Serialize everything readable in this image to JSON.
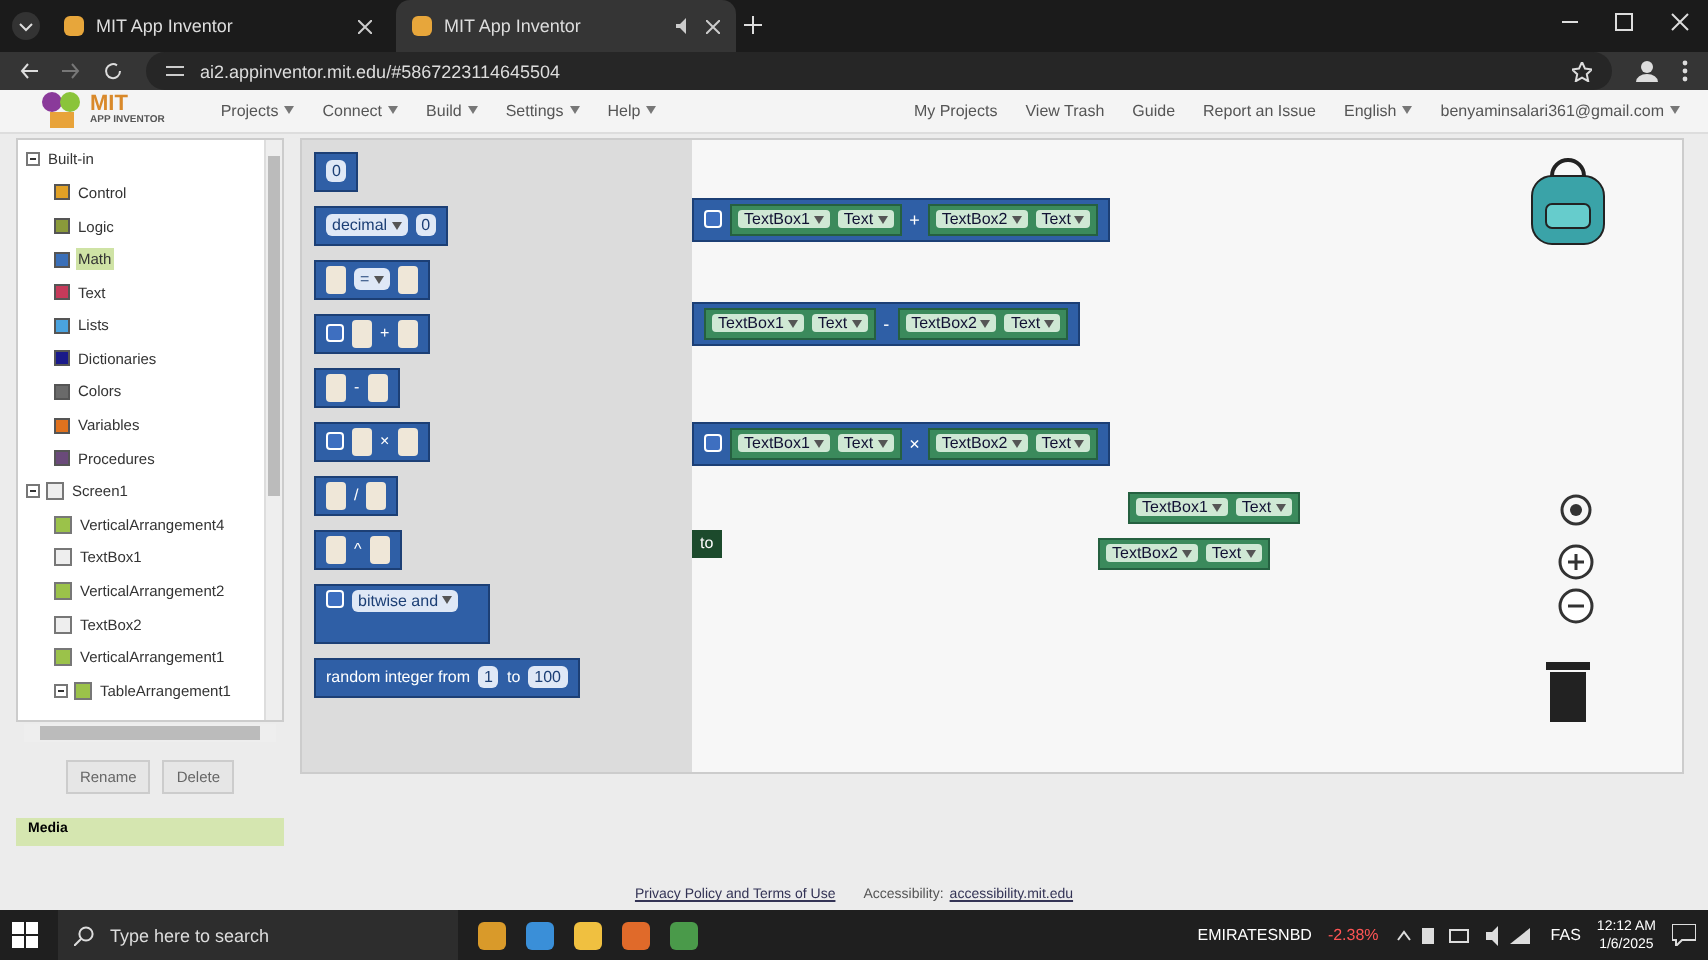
{
  "browser": {
    "tabs": [
      {
        "title": "MIT App Inventor",
        "selected": false,
        "audio": false
      },
      {
        "title": "MIT App Inventor",
        "selected": true,
        "audio": true
      }
    ],
    "url": "ai2.appinventor.mit.edu/#5867223114645504"
  },
  "app_header": {
    "logo": {
      "title": "MIT",
      "subtitle": "APP INVENTOR"
    },
    "menus": [
      "Projects",
      "Connect",
      "Build",
      "Settings",
      "Help"
    ],
    "links": [
      "My Projects",
      "View Trash",
      "Guide",
      "Report an Issue"
    ],
    "language": "English",
    "account": "benyaminsalari361@gmail.com"
  },
  "tree": {
    "items": [
      {
        "label": "Built-in",
        "kind": "group",
        "expanded": true,
        "children": [
          {
            "label": "Control",
            "kind": "drawer",
            "color": "#e1a126",
            "selected": false
          },
          {
            "label": "Logic",
            "kind": "drawer",
            "color": "#8a9a3a",
            "selected": false
          },
          {
            "label": "Math",
            "kind": "drawer",
            "color": "#3a6fb8",
            "selected": true
          },
          {
            "label": "Text",
            "kind": "drawer",
            "color": "#c63a5a",
            "selected": false
          },
          {
            "label": "Lists",
            "kind": "drawer",
            "color": "#4aa3df",
            "selected": false
          },
          {
            "label": "Dictionaries",
            "kind": "drawer",
            "color": "#1a1a8a",
            "selected": false
          },
          {
            "label": "Colors",
            "kind": "drawer",
            "color": "#6a6a6a",
            "selected": false
          },
          {
            "label": "Variables",
            "kind": "drawer",
            "color": "#e0721e",
            "selected": false
          },
          {
            "label": "Procedures",
            "kind": "drawer",
            "color": "#6a4a7a",
            "selected": false
          }
        ]
      },
      {
        "label": "Screen1",
        "kind": "screen",
        "expanded": true,
        "children": [
          {
            "label": "VerticalArrangement4",
            "kind": "arrangement",
            "selected": false
          },
          {
            "label": "TextBox1",
            "kind": "textbox",
            "selected": false
          },
          {
            "label": "VerticalArrangement2",
            "kind": "arrangement",
            "selected": false
          },
          {
            "label": "TextBox2",
            "kind": "textbox",
            "selected": false
          },
          {
            "label": "VerticalArrangement1",
            "kind": "arrangement",
            "selected": false
          },
          {
            "label": "TableArrangement1",
            "kind": "table",
            "expanded": true,
            "selected": false
          }
        ]
      }
    ]
  },
  "tree_buttons": [
    "Rename",
    "Delete"
  ],
  "media_label": "Media",
  "flyout": [
    {
      "kind": "number",
      "value": "0"
    },
    {
      "kind": "decimal",
      "label": "decimal",
      "value": "0"
    },
    {
      "kind": "binary",
      "op": "=",
      "op_dropdown": true,
      "mutator": false
    },
    {
      "kind": "binary",
      "op": "+",
      "op_dropdown": false,
      "mutator": true
    },
    {
      "kind": "binary",
      "op": "-",
      "op_dropdown": false,
      "mutator": false
    },
    {
      "kind": "binary",
      "op": "×",
      "op_dropdown": false,
      "mutator": true
    },
    {
      "kind": "binary",
      "op": "/",
      "op_dropdown": false,
      "mutator": false
    },
    {
      "kind": "binary",
      "op": "^",
      "op_dropdown": false,
      "mutator": false
    },
    {
      "kind": "bitwise",
      "label": "bitwise and",
      "mutator": true
    },
    {
      "kind": "random",
      "label": "random integer from",
      "from": "1",
      "to_label": "to",
      "to": "100"
    }
  ],
  "workspace": {
    "blocks": [
      {
        "kind": "expression",
        "mutator": true,
        "left": {
          "component": "TextBox1",
          "property": "Text"
        },
        "op": "+",
        "right": {
          "component": "TextBox2",
          "property": "Text"
        }
      },
      {
        "kind": "expression",
        "mutator": false,
        "left": {
          "component": "TextBox1",
          "property": "Text"
        },
        "op": "-",
        "right": {
          "component": "TextBox2",
          "property": "Text"
        }
      },
      {
        "kind": "expression",
        "mutator": true,
        "left": {
          "component": "TextBox1",
          "property": "Text"
        },
        "op": "×",
        "right": {
          "component": "TextBox2",
          "property": "Text"
        }
      },
      {
        "kind": "getter",
        "component": "TextBox1",
        "property": "Text"
      },
      {
        "kind": "getter",
        "component": "TextBox2",
        "property": "Text"
      }
    ],
    "set_fragment": "to"
  },
  "footer": {
    "privacy": "Privacy Policy and Terms of Use",
    "accessibility_label": "Accessibility:",
    "accessibility_link": "accessibility.mit.edu"
  },
  "taskbar": {
    "search_placeholder": "Type here to search",
    "stock": {
      "name": "EMIRATESNBD",
      "change": "-2.38%"
    },
    "input_language": "FAS",
    "time": "12:12 AM",
    "date": "1/6/2025"
  }
}
